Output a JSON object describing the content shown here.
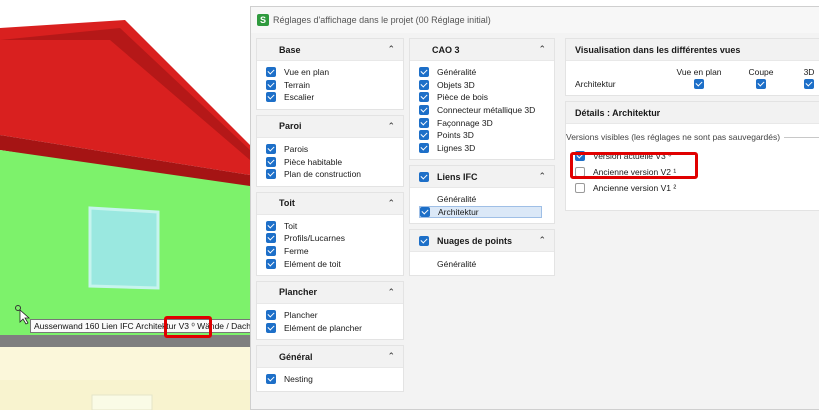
{
  "viewport": {
    "tooltip_text": "Aussenwand 160 Lien IFC Architektur V3 ⁰ Wände / Dach"
  },
  "dialog": {
    "title": "Réglages d'affichage dans le projet (00 Réglage initial)"
  },
  "col1": {
    "base": {
      "title": "Base",
      "items": [
        "Vue en plan",
        "Terrain",
        "Escalier"
      ]
    },
    "paroi": {
      "title": "Paroi",
      "items": [
        "Parois",
        "Pièce habitable",
        "Plan de construction"
      ]
    },
    "toit": {
      "title": "Toit",
      "items": [
        "Toit",
        "Profils/Lucarnes",
        "Ferme",
        "Elément de toit"
      ]
    },
    "plancher": {
      "title": "Plancher",
      "items": [
        "Plancher",
        "Elément de plancher"
      ]
    },
    "general": {
      "title": "Général",
      "items": [
        "Nesting"
      ]
    }
  },
  "col2": {
    "cao3": {
      "title": "CAO 3",
      "items": [
        "Généralité",
        "Objets 3D",
        "Pièce de bois",
        "Connecteur métallique 3D",
        "Façonnage 3D",
        "Points 3D",
        "Lignes 3D"
      ]
    },
    "liens_ifc": {
      "title": "Liens IFC",
      "items": [
        "Généralité",
        "Architektur"
      ]
    },
    "nuages": {
      "title": "Nuages de points",
      "items": [
        "Généralité"
      ]
    }
  },
  "col3": {
    "visualisation": {
      "title": "Visualisation dans les différentes vues",
      "columns": [
        "Vue en plan",
        "Coupe",
        "3D"
      ],
      "row_label": "Architektur"
    },
    "details": {
      "title": "Détails : Architektur",
      "versions_label": "Versions visibles (les réglages ne sont pas sauvegardés)",
      "versions": [
        {
          "label": "Version actuelle V3 ⁰",
          "checked": true
        },
        {
          "label": "Ancienne version V2 ¹",
          "checked": false
        },
        {
          "label": "Ancienne version V1 ²",
          "checked": false
        }
      ]
    }
  },
  "colors": {
    "accent": "#1d6fc8",
    "highlight": "#e00000",
    "roof": "#d91f1f",
    "wall": "#7df26b"
  }
}
